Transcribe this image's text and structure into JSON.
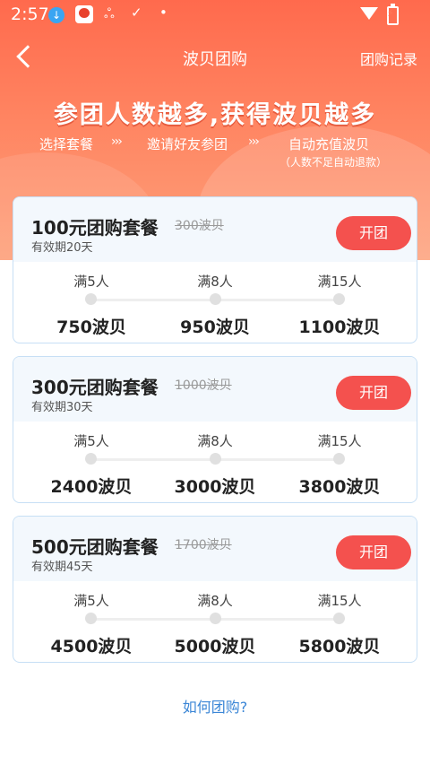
{
  "status_bar": {
    "time": "2:57",
    "icons": [
      "download-icon",
      "app-notification-icon",
      "notification-glyph-icon",
      "checkmark-icon",
      "dot-icon",
      "wifi-icon",
      "battery-charging-icon"
    ]
  },
  "nav": {
    "title": "波贝团购",
    "right_link": "团购记录"
  },
  "hero": {
    "slogan": "参团人数越多,获得波贝越多",
    "steps": [
      "选择套餐",
      "邀请好友参团",
      "自动充值波贝"
    ],
    "arrow": "›››",
    "note": "（人数不足自动退款）"
  },
  "packages": [
    {
      "title": "100元团购套餐",
      "original_price": "300波贝",
      "validity": "有效期20天",
      "button": "开团",
      "tiers": [
        {
          "label": "满5人",
          "value": "750波贝"
        },
        {
          "label": "满8人",
          "value": "950波贝"
        },
        {
          "label": "满15人",
          "value": "1100波贝"
        }
      ]
    },
    {
      "title": "300元团购套餐",
      "original_price": "1000波贝",
      "validity": "有效期30天",
      "button": "开团",
      "tiers": [
        {
          "label": "满5人",
          "value": "2400波贝"
        },
        {
          "label": "满8人",
          "value": "3000波贝"
        },
        {
          "label": "满15人",
          "value": "3800波贝"
        }
      ]
    },
    {
      "title": "500元团购套餐",
      "original_price": "1700波贝",
      "validity": "有效期45天",
      "button": "开团",
      "tiers": [
        {
          "label": "满5人",
          "value": "4500波贝"
        },
        {
          "label": "满8人",
          "value": "5000波贝"
        },
        {
          "label": "满15人",
          "value": "5800波贝"
        }
      ]
    }
  ],
  "footer": {
    "how_link": "如何团购?"
  },
  "colors": {
    "accent": "#f4514e",
    "hero_top": "#ff6a4d",
    "link": "#3b86d6",
    "card_border": "#c7dff5"
  }
}
